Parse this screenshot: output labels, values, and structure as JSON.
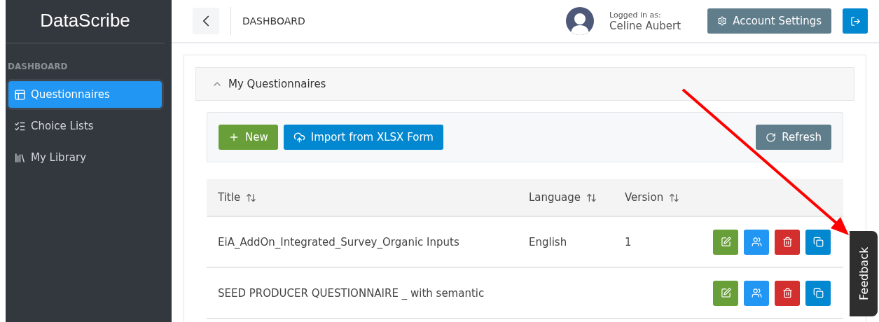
{
  "sidebar": {
    "brand": "DataScribe",
    "section": "DASHBOARD",
    "items": [
      {
        "label": "Questionnaires",
        "selected": true
      },
      {
        "label": "Choice Lists",
        "selected": false
      },
      {
        "label": "My Library",
        "selected": false
      }
    ]
  },
  "header": {
    "title": "DASHBOARD",
    "user_caption": "Logged in as:",
    "user_name": "Celine Aubert",
    "settings_button": "Account Settings"
  },
  "panel": {
    "title": "My Questionnaires",
    "expanded": true,
    "toolbar": {
      "new_button": "New",
      "import_button": "Import from XLSX Form",
      "refresh_button": "Refresh"
    },
    "table": {
      "columns": [
        "Title",
        "Language",
        "Version"
      ],
      "rows": [
        {
          "title": "EiA_AddOn_Integrated_Survey_Organic Inputs",
          "language": "English",
          "version": "1"
        },
        {
          "title": "SEED PRODUCER QUESTIONNAIRE _ with semantic"
        }
      ]
    }
  },
  "feedback_tab": "Feedback"
}
